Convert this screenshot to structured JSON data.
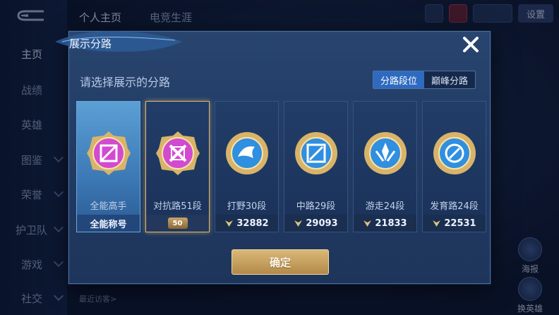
{
  "background": {
    "tabs": [
      {
        "label": "个人主页",
        "active": true
      },
      {
        "label": "电竞生涯",
        "active": false
      }
    ],
    "nav": [
      {
        "label": "主页",
        "active": true
      },
      {
        "label": "战绩",
        "active": false
      },
      {
        "label": "英雄",
        "active": false
      },
      {
        "label": "图鉴",
        "active": false
      },
      {
        "label": "荣誉",
        "active": false
      },
      {
        "label": "护卫队",
        "active": false
      },
      {
        "label": "游戏",
        "active": false
      },
      {
        "label": "社交",
        "active": false
      }
    ],
    "settings_label": "设置",
    "recent_visitors": "最近访客>",
    "right_buttons": {
      "poster": "海报",
      "change_hero": "换英雄"
    }
  },
  "modal": {
    "title": "展示分路",
    "subtitle": "请选择展示的分路",
    "segment": {
      "options": [
        "分路段位",
        "巅峰分路"
      ],
      "selected": "分路段位"
    },
    "cards": [
      {
        "label": "全能高手",
        "footer": "全能称号",
        "emblem_color": "#d24ad0",
        "selected": false,
        "kind": "title"
      },
      {
        "label": "对抗路51段",
        "footer": "50",
        "emblem_color": "#d24ad0",
        "selected": true,
        "kind": "level"
      },
      {
        "label": "打野30段",
        "footer": "32882",
        "emblem_color": "#2f8fe0",
        "selected": false,
        "kind": "points"
      },
      {
        "label": "中路29段",
        "footer": "29093",
        "emblem_color": "#2f8fe0",
        "selected": false,
        "kind": "points"
      },
      {
        "label": "游走24段",
        "footer": "21833",
        "emblem_color": "#2f8fe0",
        "selected": false,
        "kind": "points"
      },
      {
        "label": "发育路24段",
        "footer": "22531",
        "emblem_color": "#2f8fe0",
        "selected": false,
        "kind": "points"
      }
    ],
    "confirm_label": "确定"
  },
  "colors": {
    "accent_gold": "#d9b878",
    "selected_border": "#e0b56d",
    "segment_active": "#2e6bc0"
  }
}
